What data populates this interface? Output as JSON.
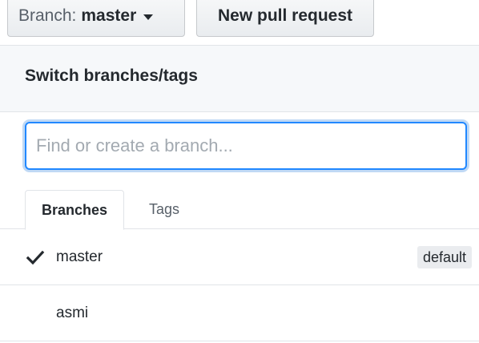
{
  "toolbar": {
    "branch_prefix": "Branch:",
    "branch_name": "master",
    "new_pull_request_label": "New pull request"
  },
  "dropdown": {
    "title": "Switch branches/tags",
    "search_placeholder": "Find or create a branch...",
    "search_value": "",
    "tabs": [
      {
        "label": "Branches",
        "selected": true
      },
      {
        "label": "Tags",
        "selected": false
      }
    ],
    "branches": [
      {
        "name": "master",
        "selected": true,
        "badge": "default"
      },
      {
        "name": "asmi",
        "selected": false,
        "badge": ""
      }
    ]
  },
  "icons": {
    "caret": "chevron-down-icon",
    "check": "check-icon"
  },
  "colors": {
    "focus_border": "#2188ff",
    "header_bg": "#f6f8fa",
    "badge_bg": "#eaecef"
  }
}
